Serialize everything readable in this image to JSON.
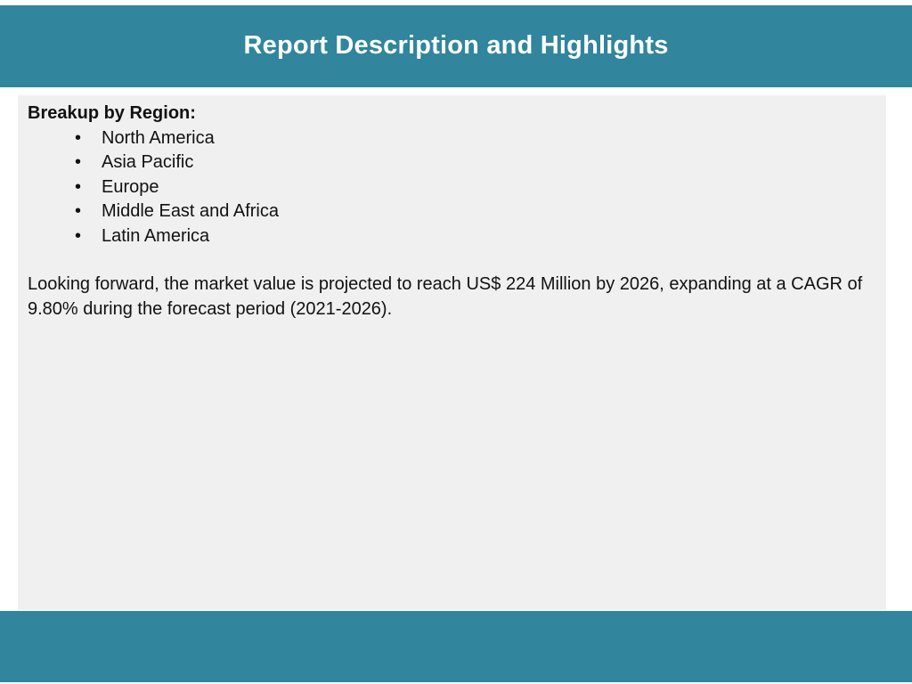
{
  "colors": {
    "accent": "#31859c",
    "panel_background": "#f0f0f0",
    "text": "#111111",
    "header_text": "#ffffff"
  },
  "header": {
    "title": "Report Description and Highlights"
  },
  "content": {
    "heading": "Breakup by Region:",
    "bullet_glyph": "•",
    "regions": [
      "North America",
      "Asia Pacific",
      "Europe",
      "Middle East and Africa",
      "Latin America"
    ],
    "summary": "Looking forward, the market value is projected to reach US$ 224 Million by 2026, expanding at a CAGR of 9.80% during the forecast period (2021-2026)."
  }
}
